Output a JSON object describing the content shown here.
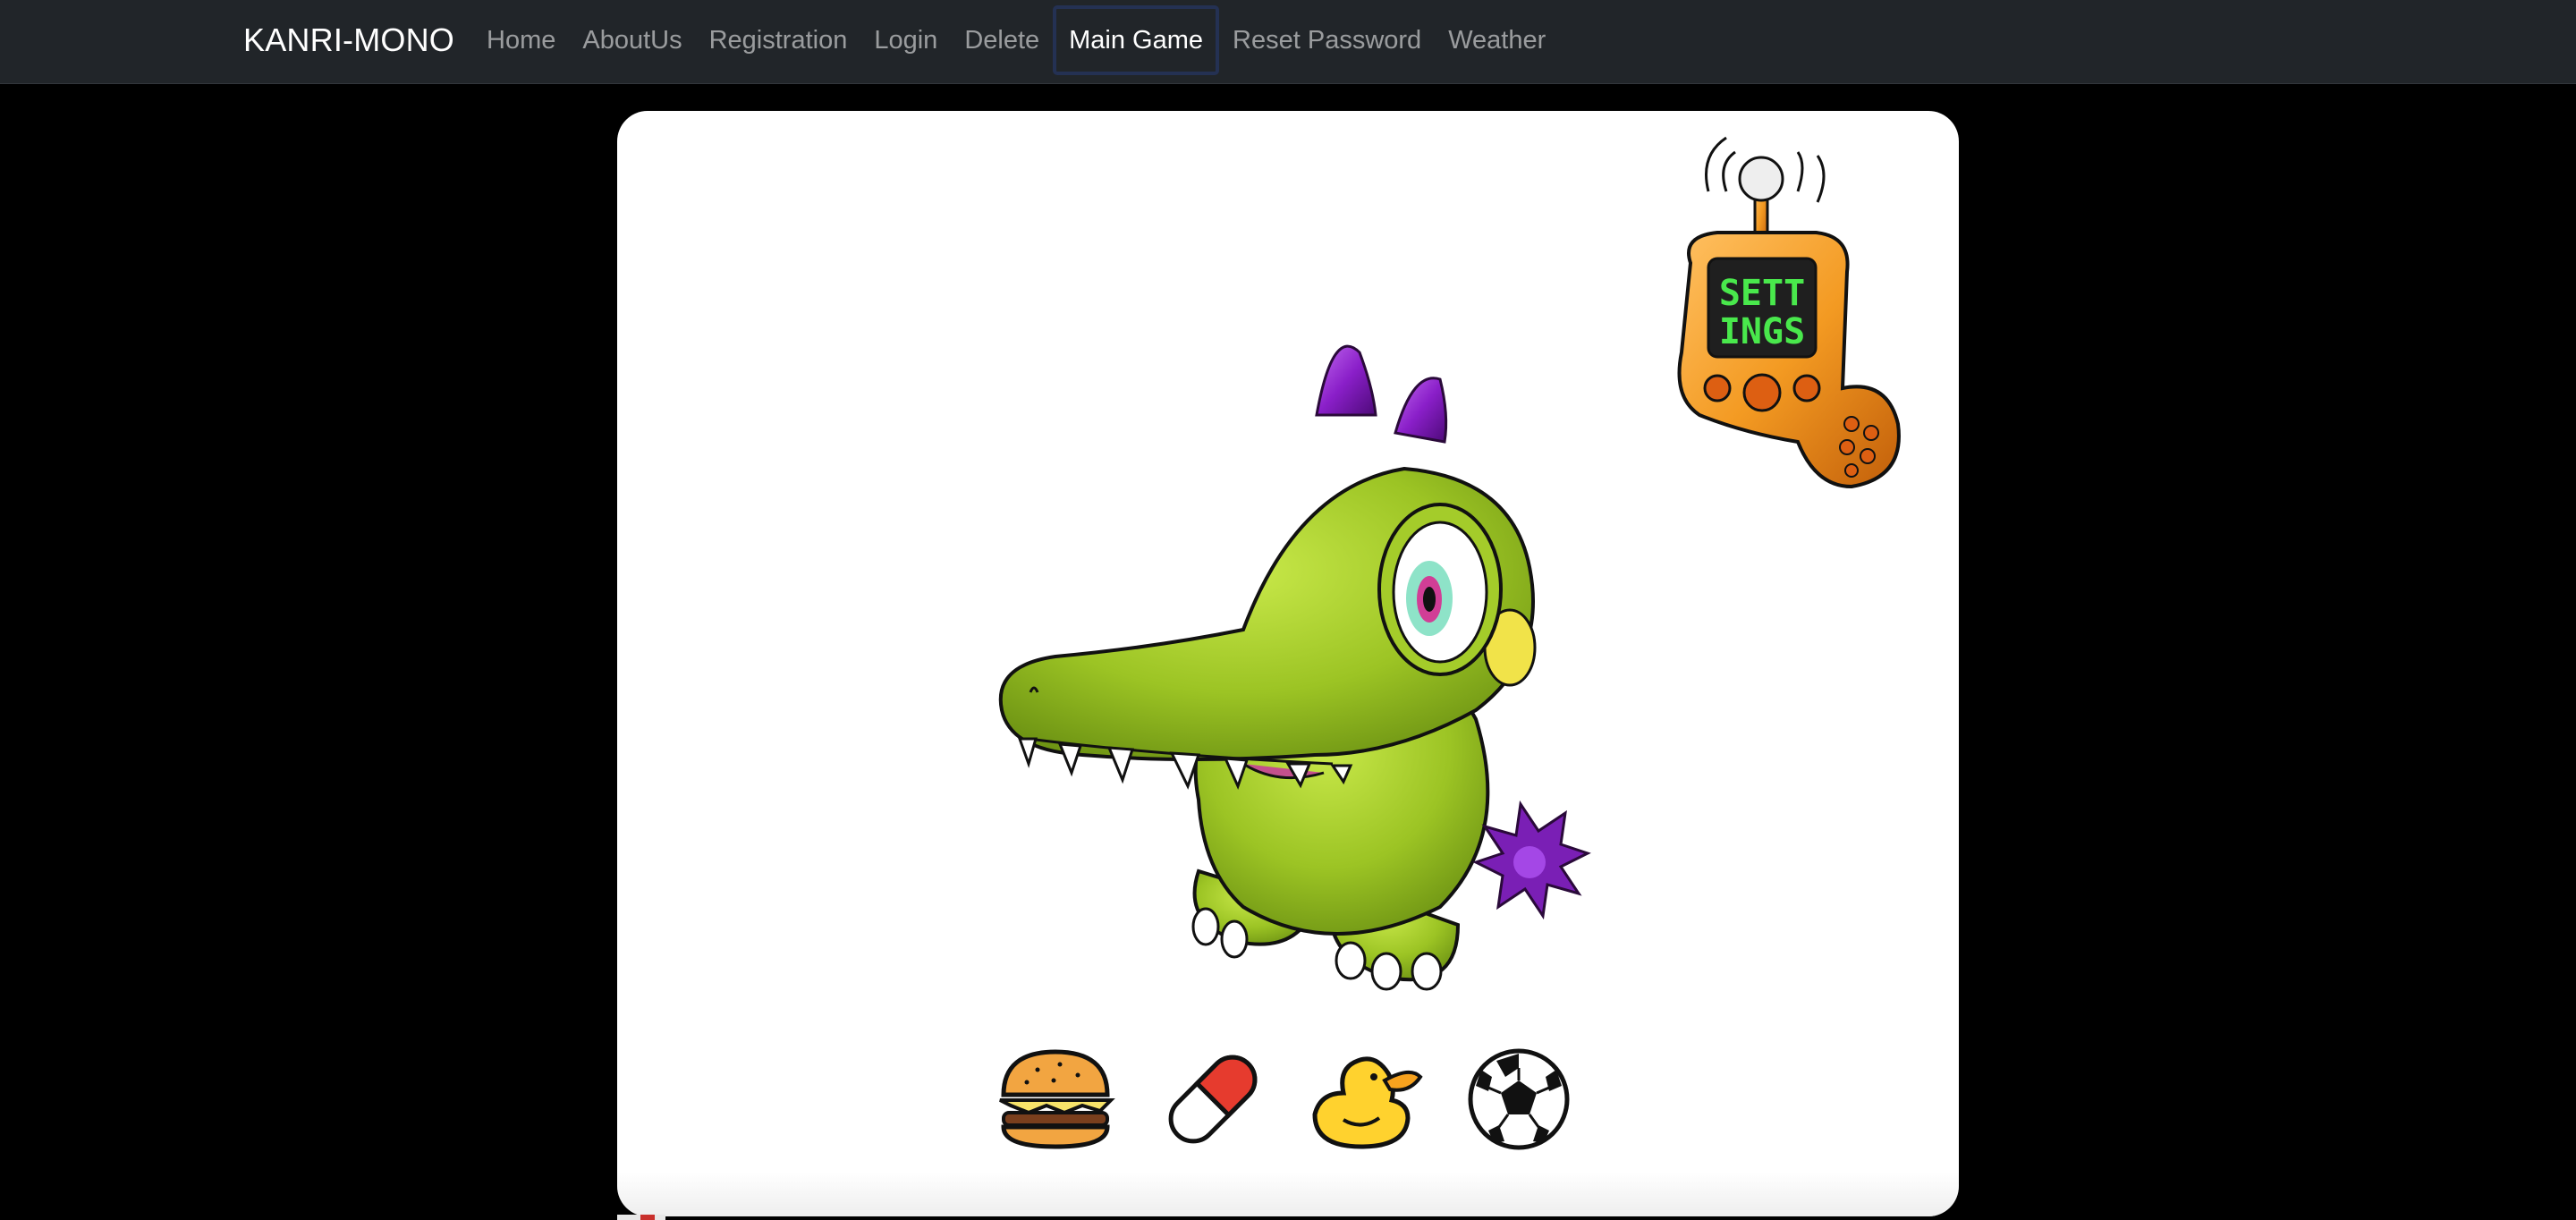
{
  "navbar": {
    "brand": "KANRI-MONO",
    "links": [
      {
        "label": "Home"
      },
      {
        "label": "AboutUs"
      },
      {
        "label": "Registration"
      },
      {
        "label": "Login"
      },
      {
        "label": "Delete"
      },
      {
        "label": "Main Game",
        "active": true
      },
      {
        "label": "Reset Password"
      },
      {
        "label": "Weather"
      }
    ]
  },
  "game": {
    "settings_button": {
      "screen_line1": "SETT",
      "screen_line2": "INGS"
    },
    "pet": {
      "icon": "green-crocodile-pet"
    },
    "items": [
      {
        "name": "burger",
        "icon": "burger-icon"
      },
      {
        "name": "pill",
        "icon": "pill-icon"
      },
      {
        "name": "rubber-duck",
        "icon": "rubber-duck-icon"
      },
      {
        "name": "soccer-ball",
        "icon": "soccer-ball-icon"
      }
    ]
  },
  "colors": {
    "navbar_bg": "#212529",
    "page_bg": "#000000",
    "card_bg": "#ffffff",
    "active_border": "#243153",
    "pet_green": "#a8d12e",
    "horn_purple": "#8a1fc9",
    "device_orange": "#f39a22",
    "screen_green": "#49e84c"
  }
}
